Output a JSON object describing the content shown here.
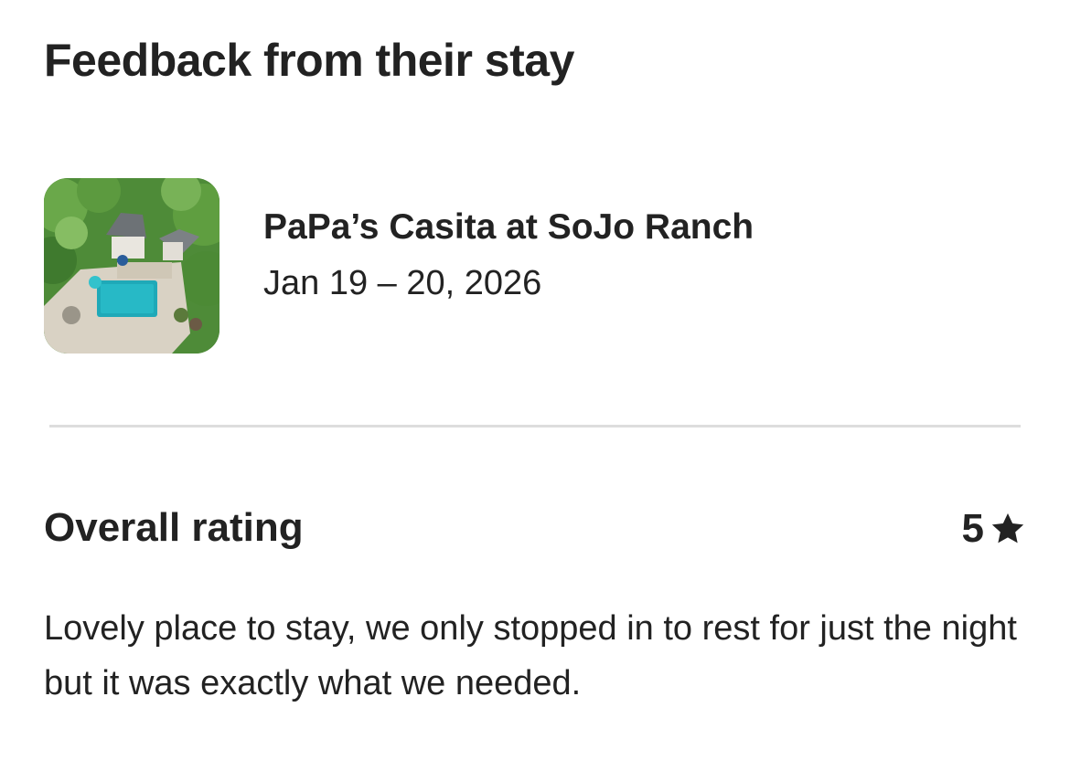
{
  "header": {
    "title": "Feedback from their stay"
  },
  "listing": {
    "name": "PaPa’s Casita at SoJo Ranch",
    "dates": "Jan 19 – 20, 2026",
    "thumbnail_icon": "listing-photo"
  },
  "rating": {
    "label": "Overall rating",
    "value": "5",
    "icon": "star-icon"
  },
  "review": {
    "text": "Lovely place to stay, we only stopped in to rest for just the night but it was exactly what we needed."
  },
  "colors": {
    "text": "#222222",
    "divider": "#dddddd",
    "background": "#ffffff"
  }
}
